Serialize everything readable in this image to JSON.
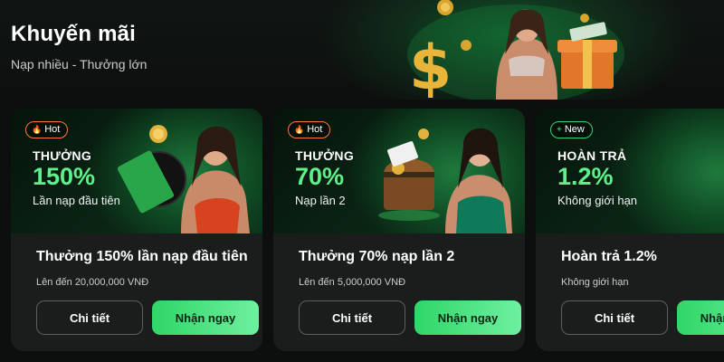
{
  "header": {
    "title": "Khuyến mãi",
    "subtitle": "Nạp nhiều - Thưởng lớn"
  },
  "cards": [
    {
      "badge": "Hot",
      "badge_icon": "fire-icon",
      "kicker": "THƯỞNG",
      "value": "150%",
      "note": "Lần nạp đầu tiên",
      "title": "Thưởng 150% lần nạp đầu tiên",
      "desc": "Lên đến 20,000,000 VNĐ",
      "detail_label": "Chi tiết",
      "claim_label": "Nhận ngay"
    },
    {
      "badge": "Hot",
      "badge_icon": "fire-icon",
      "kicker": "THƯỞNG",
      "value": "70%",
      "note": "Nạp lần 2",
      "title": "Thưởng 70% nạp lần 2",
      "desc": "Lên đến 5,000,000 VNĐ",
      "detail_label": "Chi tiết",
      "claim_label": "Nhận ngay"
    },
    {
      "badge": "New",
      "badge_icon": "plus-icon",
      "kicker": "HOÀN TRẢ",
      "value": "1.2%",
      "note": "Không giới hạn",
      "title": "Hoàn trả 1.2%",
      "desc": "Không giới hạn",
      "detail_label": "Chi tiết",
      "claim_label": "Nhận ngay"
    }
  ],
  "colors": {
    "accent_green": "#5ef08a",
    "hot_badge": "#ff7a3d",
    "new_badge": "#36d17a",
    "card_bg": "#1b1d1c",
    "page_bg": "#0d0f0e"
  }
}
